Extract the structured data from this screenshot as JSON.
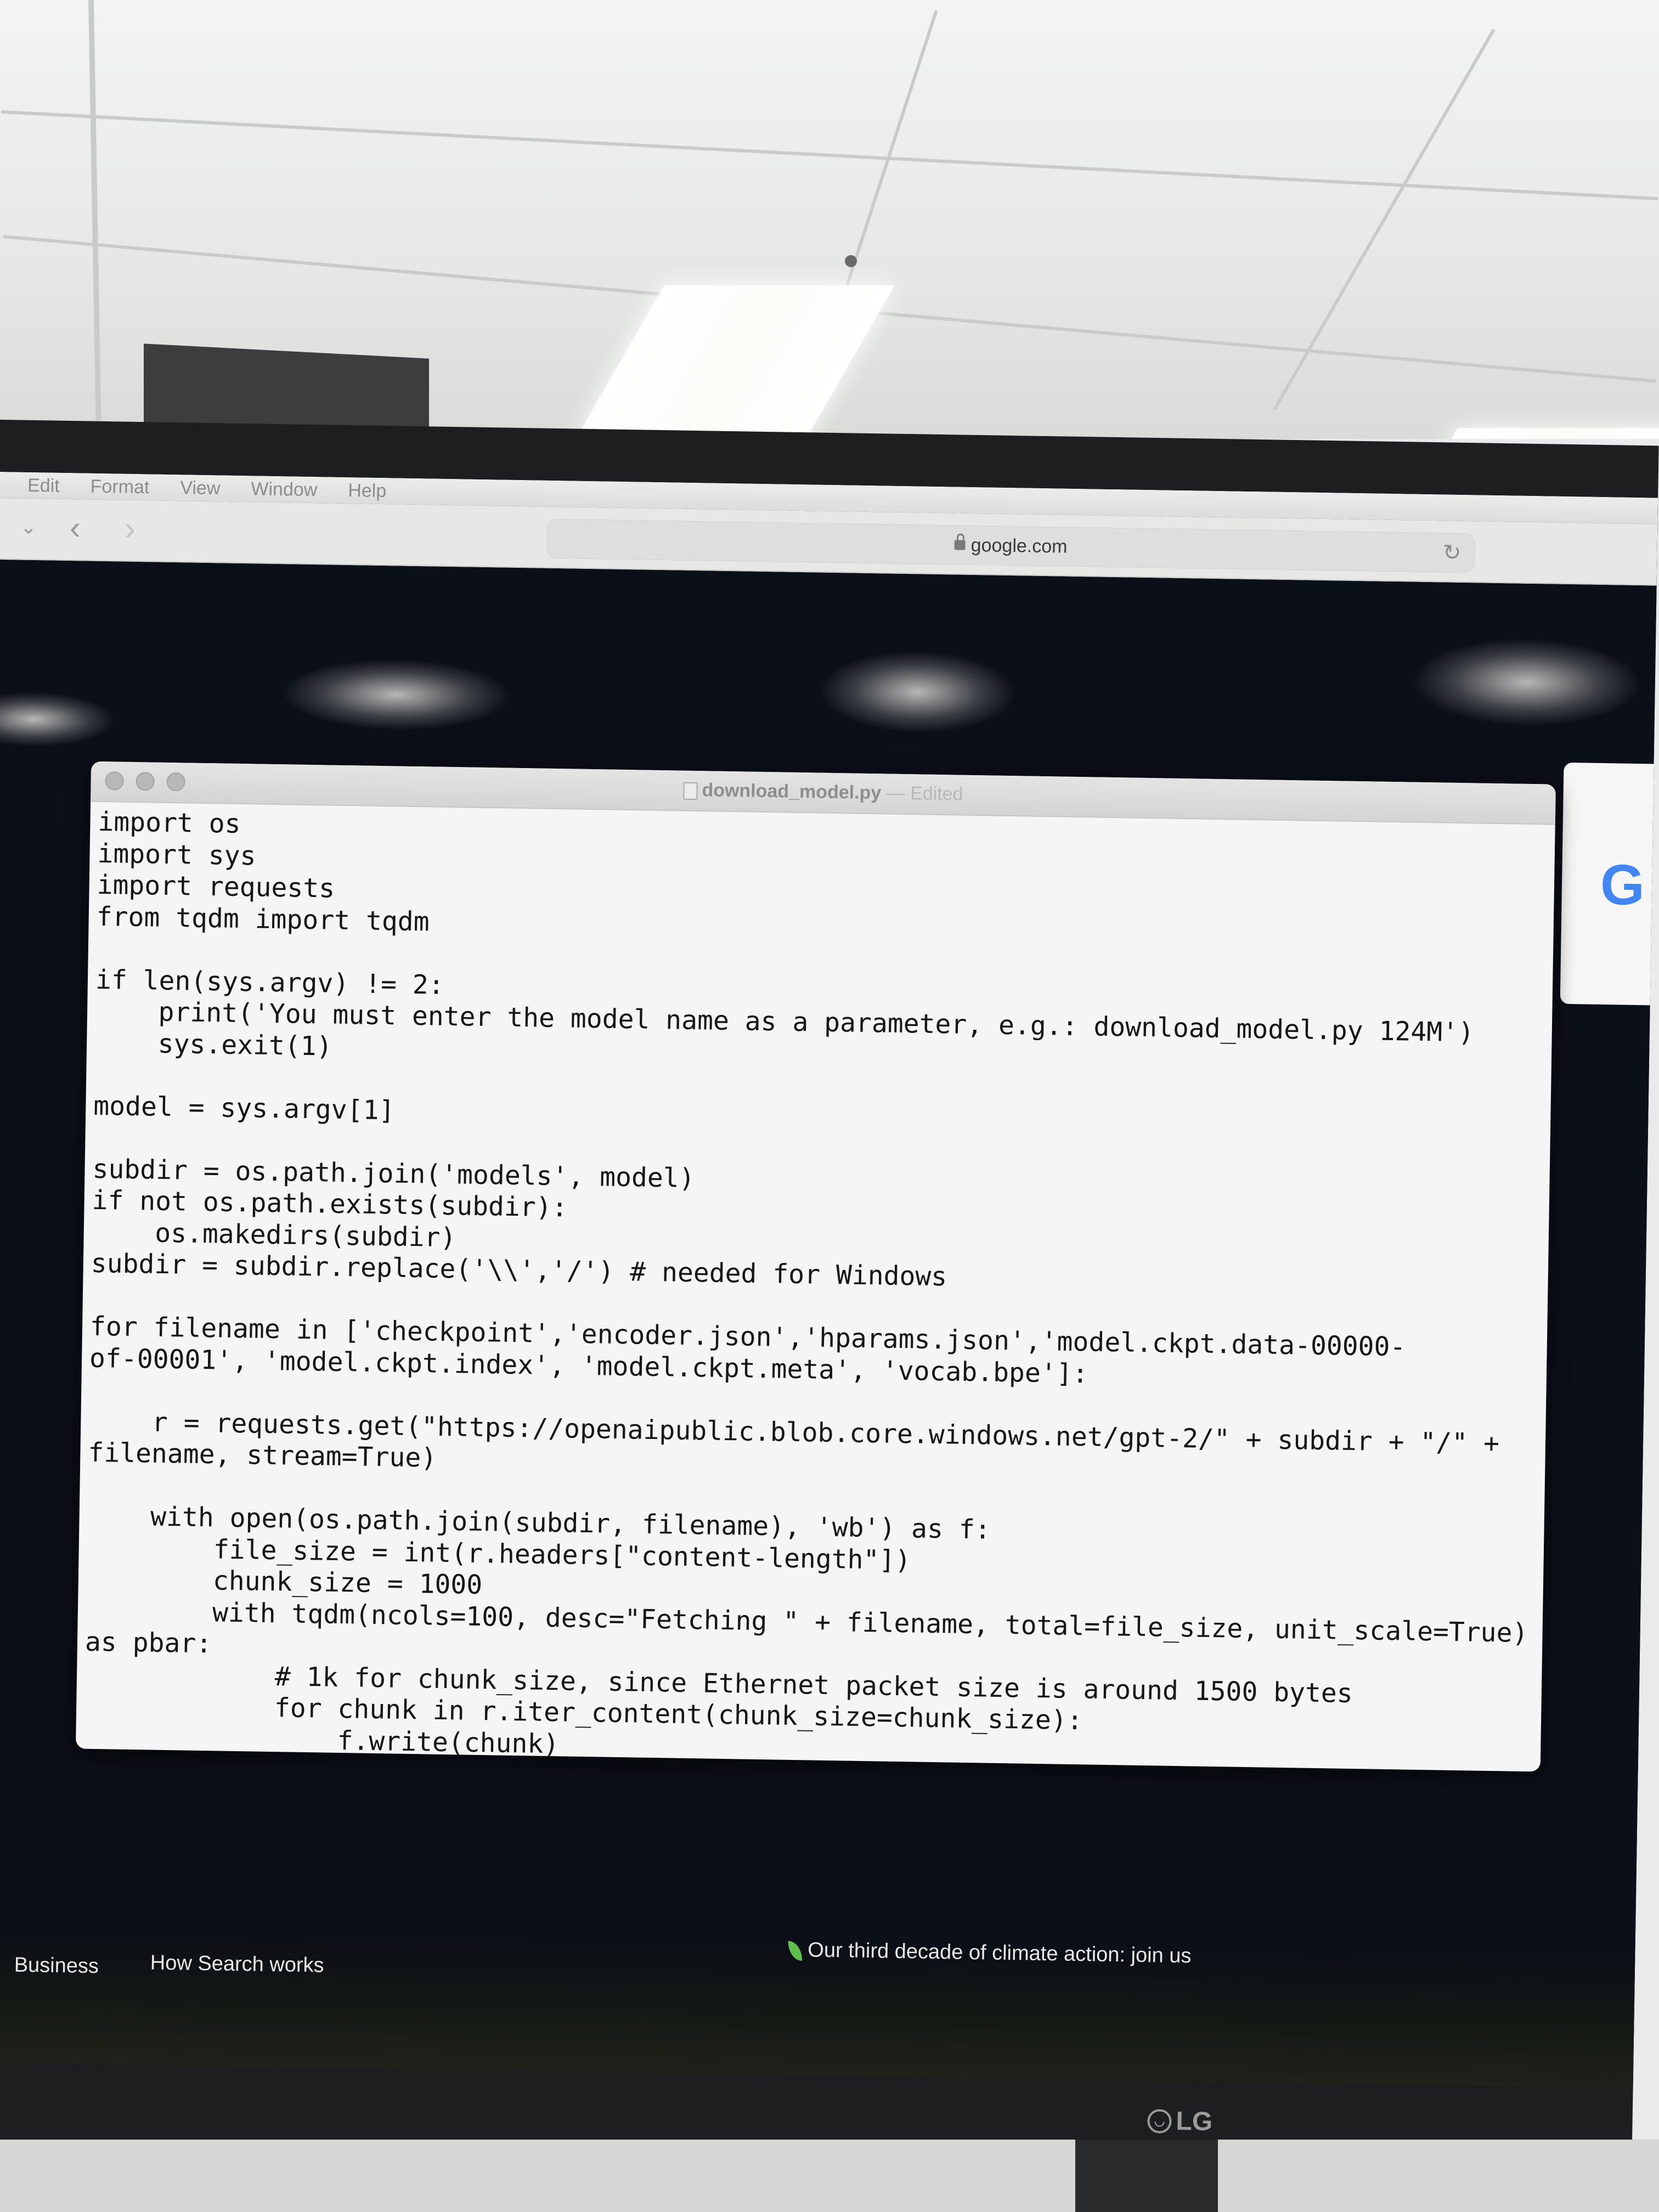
{
  "menubar": {
    "items": [
      "Edit",
      "Format",
      "View",
      "Window",
      "Help"
    ]
  },
  "browser": {
    "url": "google.com"
  },
  "editor": {
    "filename": "download_model.py",
    "status": "— Edited",
    "code": "import os\nimport sys\nimport requests\nfrom tqdm import tqdm\n\nif len(sys.argv) != 2:\n    print('You must enter the model name as a parameter, e.g.: download_model.py 124M')\n    sys.exit(1)\n\nmodel = sys.argv[1]\n\nsubdir = os.path.join('models', model)\nif not os.path.exists(subdir):\n    os.makedirs(subdir)\nsubdir = subdir.replace('\\\\','/') # needed for Windows\n\nfor filename in ['checkpoint','encoder.json','hparams.json','model.ckpt.data-00000-\nof-00001', 'model.ckpt.index', 'model.ckpt.meta', 'vocab.bpe']:\n\n    r = requests.get(\"https://openaipublic.blob.core.windows.net/gpt-2/\" + subdir + \"/\" +\nfilename, stream=True)\n\n    with open(os.path.join(subdir, filename), 'wb') as f:\n        file_size = int(r.headers[\"content-length\"])\n        chunk_size = 1000\n        with tqdm(ncols=100, desc=\"Fetching \" + filename, total=file_size, unit_scale=True)\nas pbar:\n            # 1k for chunk_size, since Ethernet packet size is around 1500 bytes\n            for chunk in r.iter_content(chunk_size=chunk_size):\n                f.write(chunk)"
  },
  "google_footer": {
    "business": "Business",
    "how_search_works": "How Search works",
    "climate": "Our third decade of climate action: join us"
  },
  "google_logo": "G",
  "monitor_brand": "LG",
  "icons": {
    "lock": "lock-icon",
    "reload": "reload-icon",
    "leaf": "leaf-icon",
    "back": "back-icon",
    "forward": "forward-icon"
  }
}
